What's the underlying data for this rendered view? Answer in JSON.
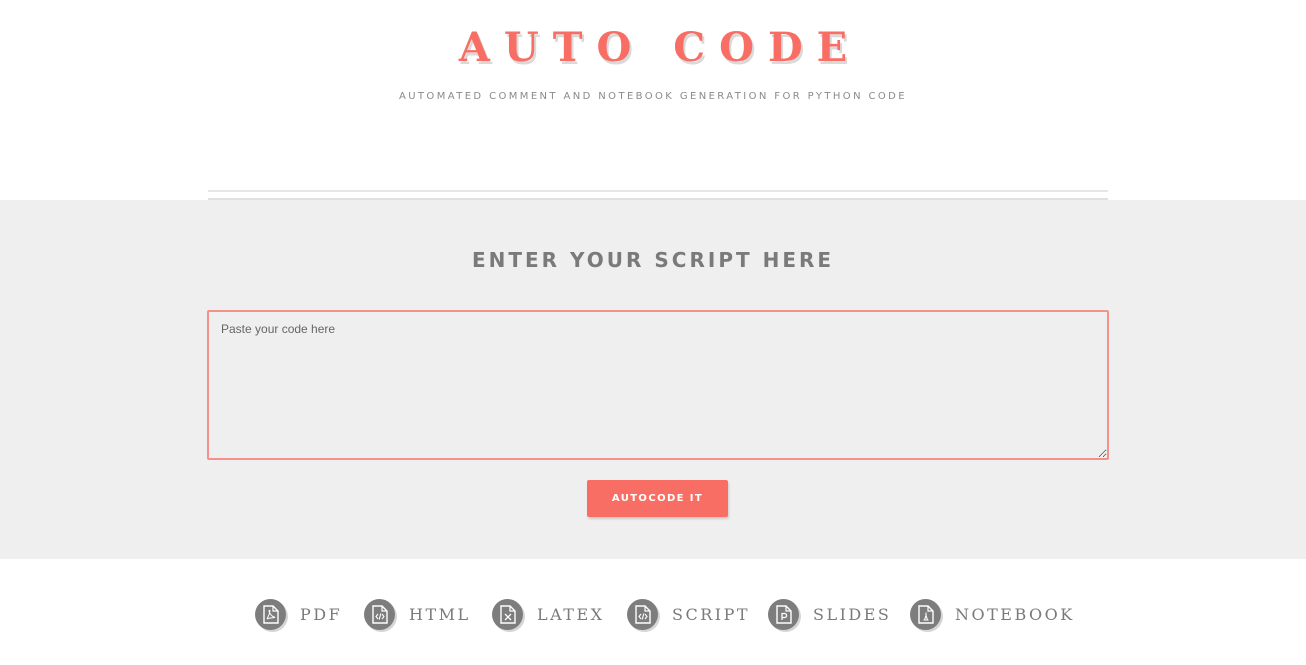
{
  "header": {
    "title": "AUTO CODE",
    "subtitle": "AUTOMATED COMMENT AND NOTEBOOK GENERATION FOR PYTHON CODE"
  },
  "main": {
    "heading": "ENTER YOUR SCRIPT HERE",
    "code_input": {
      "placeholder": "Paste your code here",
      "value": ""
    },
    "submit_label": "AUTOCODE IT"
  },
  "exports": [
    {
      "label": "PDF",
      "icon": "pdf-file-icon",
      "glyph": "pdf"
    },
    {
      "label": "HTML",
      "icon": "html-file-icon",
      "glyph": "</>"
    },
    {
      "label": "LATEX",
      "icon": "latex-file-icon",
      "glyph": "X"
    },
    {
      "label": "SCRIPT",
      "icon": "script-file-icon",
      "glyph": "</>"
    },
    {
      "label": "SLIDES",
      "icon": "slides-file-icon",
      "glyph": "P"
    },
    {
      "label": "NOTEBOOK",
      "icon": "notebook-file-icon",
      "glyph": "pen"
    }
  ],
  "colors": {
    "accent": "#f96e64",
    "panel_bg": "#efefef",
    "icon_bg": "#7d7d7d"
  }
}
